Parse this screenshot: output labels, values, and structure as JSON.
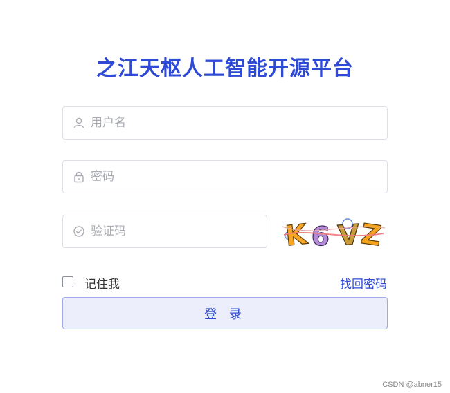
{
  "app": {
    "title": "之江天枢人工智能开源平台"
  },
  "form": {
    "username": {
      "placeholder": "用户名",
      "value": "",
      "icon": "user-icon"
    },
    "password": {
      "placeholder": "密码",
      "value": "",
      "icon": "lock-icon"
    },
    "captcha": {
      "placeholder": "验证码",
      "value": "",
      "icon": "check-circle-icon",
      "image_text": "K6VZ"
    },
    "remember_label": "记住我",
    "remember_checked": false,
    "forgot_label": "找回密码",
    "login_label": "登 录"
  },
  "watermark": "CSDN @abner15",
  "colors": {
    "accent": "#2f4bd6",
    "button_bg": "#eceefb",
    "button_border": "#9fa9e8",
    "input_border": "#dcdfe6",
    "placeholder": "#a8abb2"
  }
}
